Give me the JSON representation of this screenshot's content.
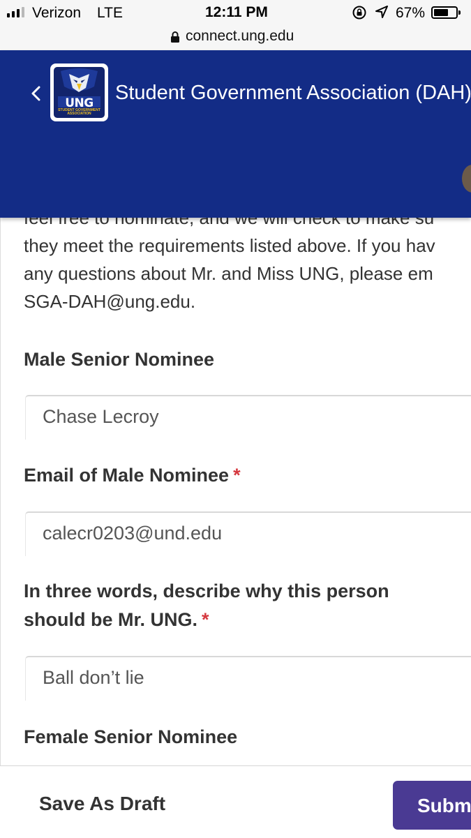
{
  "status_bar": {
    "carrier": "Verizon",
    "network": "LTE",
    "time": "12:11 PM",
    "battery": "67%",
    "battery_level": 0.67,
    "icons": [
      "signal-icon",
      "rotation-lock-icon",
      "location-icon",
      "battery-icon"
    ]
  },
  "browser": {
    "url": "connect.ung.edu",
    "icons": [
      "lock-icon"
    ]
  },
  "header": {
    "title": "Student Government Association (DAH)",
    "logo_text": "UNG",
    "logo_subtext": "STUDENT GOVERNMENT ASSOCIATION",
    "brand_color": "#132c86",
    "icons": [
      "back-chevron-icon",
      "ung-logo",
      "avatar"
    ]
  },
  "form": {
    "description_lines": [
      "feel free to nominate, and we will check to make su",
      "they meet the requirements listed above. If you hav",
      "any questions about Mr. and Miss UNG, please em",
      "SGA-DAH@ung.edu."
    ],
    "required_marker": "*",
    "fields": [
      {
        "label": "Male Senior Nominee",
        "value": "Chase Lecroy",
        "required": false
      },
      {
        "label": "Email of Male Nominee",
        "value": "calecr0203@und.edu",
        "required": true
      },
      {
        "label_lines": [
          "In three words, describe why this person",
          "should be Mr. UNG."
        ],
        "value": "Ball don’t lie",
        "required": true
      },
      {
        "label": "Female Senior Nominee",
        "required": false
      }
    ]
  },
  "actions": {
    "save_draft": "Save As Draft",
    "submit": "Submit",
    "submit_color": "#4a3a93"
  }
}
